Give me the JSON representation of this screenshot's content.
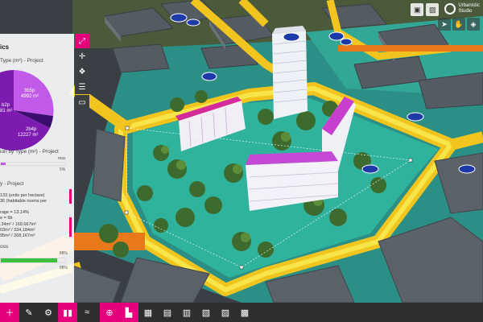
{
  "panel": {
    "title": "ics",
    "pie_title": "Type (m²) - Project",
    "pie_labels": {
      "a_code": "3b5p",
      "a_area": "4992 m²",
      "b_code": "b2p",
      "b_area": "81 m²",
      "c_code": "2b4p",
      "c_area": "12227 m²"
    },
    "bar_title": "ion by Type (m²) - Project",
    "bar_max": "max",
    "bar_value": "5%",
    "density_title": "y - Project",
    "density_lines": [
      "133 (units per hectare)",
      "36 (habitable rooms per"
    ],
    "coverage_lines": [
      "rage = 13.14%",
      "e = 6b",
      ".34m² / 169,667m²",
      "03m² / 334,184m²",
      "95m² / 268,167m²"
    ],
    "loss_title": "oss",
    "loss_value_1": "88%",
    "loss_value_2": "88%",
    "colors": {
      "pie_a": "#c15ae8",
      "pie_b": "#3b0e6e",
      "pie_c": "#7d1bb0",
      "loss": "#3fbf3f",
      "magenta": "#e6007e"
    }
  },
  "vtools": [
    "expand-icon",
    "crosshair-icon",
    "puzzle-icon",
    "sliders-icon",
    "comment-icon"
  ],
  "logo": {
    "line1": "Urbanistic",
    "line2": "Studio"
  },
  "toolbar": [
    {
      "name": "add",
      "glyph": "+"
    },
    {
      "name": "wrench",
      "glyph": "🔧"
    },
    {
      "name": "gear",
      "glyph": "⚙"
    },
    {
      "name": "chart",
      "glyph": "▮▮"
    },
    {
      "name": "approx",
      "glyph": "≈"
    },
    {
      "name": "globe",
      "glyph": "⊕"
    },
    {
      "name": "buildings",
      "glyph": "▙"
    },
    {
      "name": "block-1",
      "glyph": "▦"
    },
    {
      "name": "block-2",
      "glyph": "▤"
    },
    {
      "name": "block-3",
      "glyph": "▥"
    },
    {
      "name": "block-4",
      "glyph": "▧"
    },
    {
      "name": "block-5",
      "glyph": "▨"
    },
    {
      "name": "block-6",
      "glyph": "▩"
    }
  ]
}
